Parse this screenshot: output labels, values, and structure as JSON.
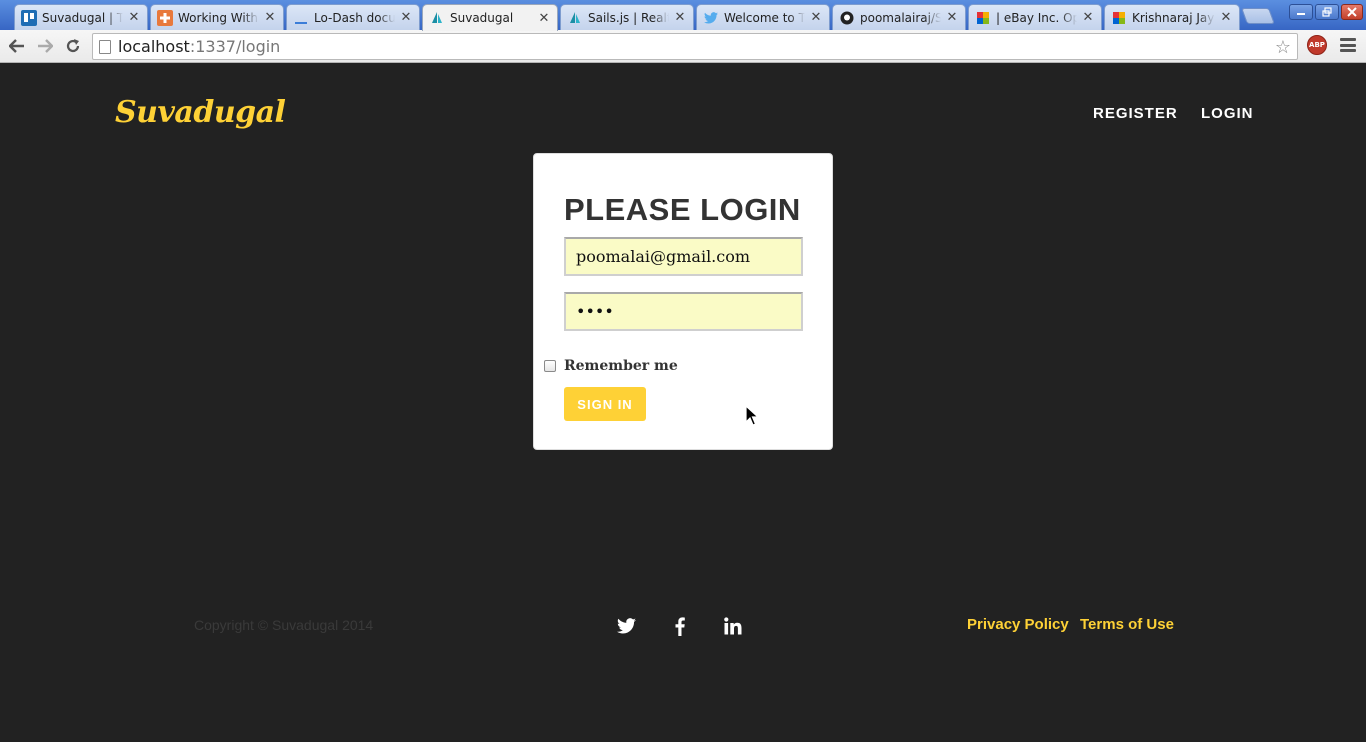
{
  "browser": {
    "tabs": [
      {
        "title": "Suvadugal | Trello",
        "icon": "trello-icon",
        "active": false
      },
      {
        "title": "Working With ...",
        "icon": "plus-icon",
        "active": false
      },
      {
        "title": "Lo-Dash documentation",
        "icon": "underscore-icon",
        "active": false
      },
      {
        "title": "Suvadugal",
        "icon": "sails-icon",
        "active": true
      },
      {
        "title": "Sails.js | Realtime",
        "icon": "sails-icon",
        "active": false
      },
      {
        "title": "Welcome to Twitter",
        "icon": "twitter-icon",
        "active": false
      },
      {
        "title": "poomalairaj/Suvadugal",
        "icon": "github-icon",
        "active": false
      },
      {
        "title": "| eBay Inc. Opportunities",
        "icon": "ebay-icon",
        "active": false
      },
      {
        "title": "Krishnaraj Jayaraman",
        "icon": "ebay-icon",
        "active": false
      }
    ],
    "url_host": "localhost",
    "url_rest": ":1337/login",
    "abp_label": "ABP"
  },
  "site": {
    "brand": "Suvadugal",
    "nav": {
      "register": "REGISTER",
      "login": "LOGIN"
    }
  },
  "login": {
    "title": "PLEASE LOGIN",
    "email_value": "poomalai@gmail.com",
    "password_value": "••••",
    "remember_label": "Remember me",
    "remember_checked": false,
    "signin_label": "SIGN IN"
  },
  "footer": {
    "copyright": "Copyright © Suvadugal 2014",
    "social": [
      "twitter-icon",
      "facebook-icon",
      "linkedin-icon"
    ],
    "links": {
      "privacy": "Privacy Policy",
      "terms": "Terms of Use"
    }
  },
  "colors": {
    "accent": "#fed136",
    "background": "#222222",
    "input_autofill": "#fafbc6"
  }
}
